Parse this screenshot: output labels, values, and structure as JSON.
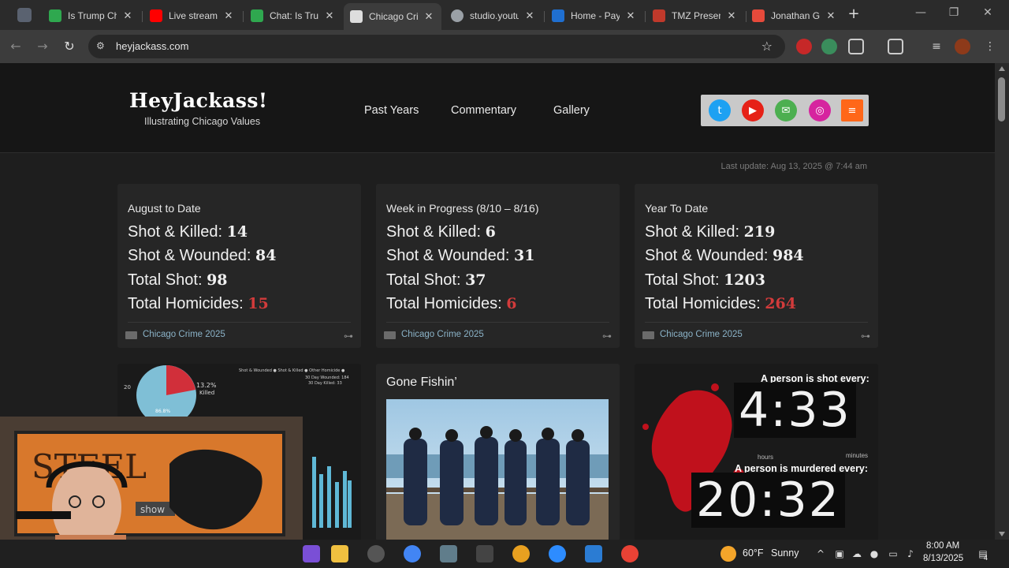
{
  "browser": {
    "tabs": [
      {
        "title": "Is Trump Ch",
        "fav_color": "#2fa84f"
      },
      {
        "title": "Live streami",
        "fav_color": "#ff0000"
      },
      {
        "title": "Chat: Is Trun",
        "fav_color": "#2fa84f"
      },
      {
        "title": "Chicago Crir",
        "fav_color": "#dddddd",
        "active": true
      },
      {
        "title": "studio.youtu",
        "fav_color": "#9aa0a6"
      },
      {
        "title": "Home - Pay",
        "fav_color": "#1f6fd1"
      },
      {
        "title": "TMZ Presen",
        "fav_color": "#c0392b"
      },
      {
        "title": "Jonathan Gi",
        "fav_color": "#e64a3b"
      }
    ],
    "url": "heyjackass.com"
  },
  "site": {
    "logo": "HeyJackass!",
    "tagline": "Illustrating Chicago Values",
    "nav": [
      "Past Years",
      "Commentary",
      "Gallery"
    ],
    "social": [
      {
        "name": "twitter",
        "color": "#1da1f2",
        "glyph": "t"
      },
      {
        "name": "youtube",
        "color": "#e62117",
        "glyph": "▶"
      },
      {
        "name": "email",
        "color": "#4caf50",
        "glyph": "✉"
      },
      {
        "name": "instagram",
        "color": "#d6249f",
        "glyph": "◎"
      },
      {
        "name": "substack",
        "color": "#ff6719",
        "glyph": "≡"
      }
    ],
    "last_update": "Last update: Aug 13, 2025 @ 7:44 am"
  },
  "cards": [
    {
      "period": "August to Date",
      "stats": [
        {
          "label": "Shot & Killed:",
          "value": "14"
        },
        {
          "label": "Shot & Wounded:",
          "value": "84"
        },
        {
          "label": "Total Shot:",
          "value": "98"
        },
        {
          "label": "Total Homicides:",
          "value": "15",
          "highlight": true
        }
      ],
      "category": "Chicago Crime 2025"
    },
    {
      "period": "Week in Progress (8/10 – 8/16)",
      "stats": [
        {
          "label": "Shot & Killed:",
          "value": "6"
        },
        {
          "label": "Shot & Wounded:",
          "value": "31"
        },
        {
          "label": "Total Shot:",
          "value": "37"
        },
        {
          "label": "Total Homicides:",
          "value": "6",
          "highlight": true
        }
      ],
      "category": "Chicago Crime 2025"
    },
    {
      "period": "Year To Date",
      "stats": [
        {
          "label": "Shot & Killed:",
          "value": "219"
        },
        {
          "label": "Shot & Wounded:",
          "value": "984"
        },
        {
          "label": "Total Shot:",
          "value": "1203"
        },
        {
          "label": "Total Homicides:",
          "value": "264",
          "highlight": true
        }
      ],
      "category": "Chicago Crime 2025"
    }
  ],
  "chart_card": {
    "pie_label": "13.2%",
    "pie_sub": "Killed",
    "pie_other": "86.8%",
    "axis_tick": "20",
    "legend": "Shot & Wounded ● Shot & Killed ● Other Homicide ●",
    "summary1": "30 Day Wounded: 184",
    "summary2": "30 Day Killed: 33"
  },
  "gone_fishin": {
    "title": "Gone Fishin’"
  },
  "clock_card": {
    "shot_line": "A person is shot every:",
    "shot_time": "4:33",
    "shot_unit_left": "hours",
    "shot_unit_right": "minutes",
    "murder_line": "A person is murdered every:",
    "murder_time": "20:32"
  },
  "webcam": {
    "sign_text": "STEEL",
    "sign_text2": "show"
  },
  "taskbar": {
    "weather_temp": "60°F",
    "weather_text": "Sunny",
    "time": "8:00 AM",
    "date": "8/13/2025",
    "notif_count": "4"
  }
}
